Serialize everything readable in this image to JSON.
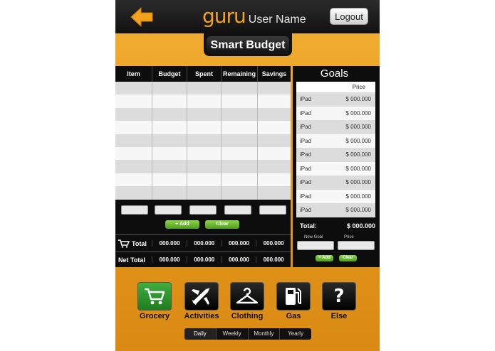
{
  "header": {
    "logo": "guru",
    "user_name": "User Name",
    "logout_label": "Logout"
  },
  "title": "Smart Budget",
  "budget": {
    "columns": [
      "Item",
      "Budget",
      "Spent",
      "Remaining",
      "Savings"
    ],
    "row_count": 9,
    "add_label": "+ Add",
    "clear_label": "Clear",
    "total_label": "Total",
    "total_values": [
      "000.000",
      "000.000",
      "000.000",
      "000.000"
    ],
    "net_total_label": "Net Total",
    "net_total_values": [
      "000.000",
      "000.000",
      "000.000",
      "000.000"
    ]
  },
  "goals": {
    "title": "Goals",
    "price_header": "Price",
    "items": [
      {
        "item": "iPad",
        "price": "$ 000.000"
      },
      {
        "item": "iPad",
        "price": "$ 000.000"
      },
      {
        "item": "iPad",
        "price": "$ 000.000"
      },
      {
        "item": "iPad",
        "price": "$ 000.000"
      },
      {
        "item": "iPad",
        "price": "$ 000.000"
      },
      {
        "item": "iPad",
        "price": "$ 000.000"
      },
      {
        "item": "iPad",
        "price": "$ 000.000"
      },
      {
        "item": "iPad",
        "price": "$ 000.000"
      },
      {
        "item": "iPad",
        "price": "$ 000.000"
      }
    ],
    "total_label": "Total:",
    "total_value": "$ 000.000",
    "new_goal_label": "New Goal",
    "price_label": "Price",
    "add_label": "+ Add",
    "clear_label": "Clear"
  },
  "categories": [
    {
      "label": "Grocery",
      "icon": "cart-icon",
      "active": true
    },
    {
      "label": "Activities",
      "icon": "airplane-icon",
      "active": false
    },
    {
      "label": "Clothing",
      "icon": "hanger-icon",
      "active": false
    },
    {
      "label": "Gas",
      "icon": "gas-pump-icon",
      "active": false
    },
    {
      "label": "Else",
      "icon": "question-icon",
      "active": false
    }
  ],
  "periods": [
    "Daily",
    "Weekly",
    "Monthly",
    "Yearly"
  ],
  "selected_period": "Daily",
  "colors": {
    "accent": "#f2a21f",
    "background_orange": "#e79a1b",
    "active_green": "#2e9a2e"
  }
}
